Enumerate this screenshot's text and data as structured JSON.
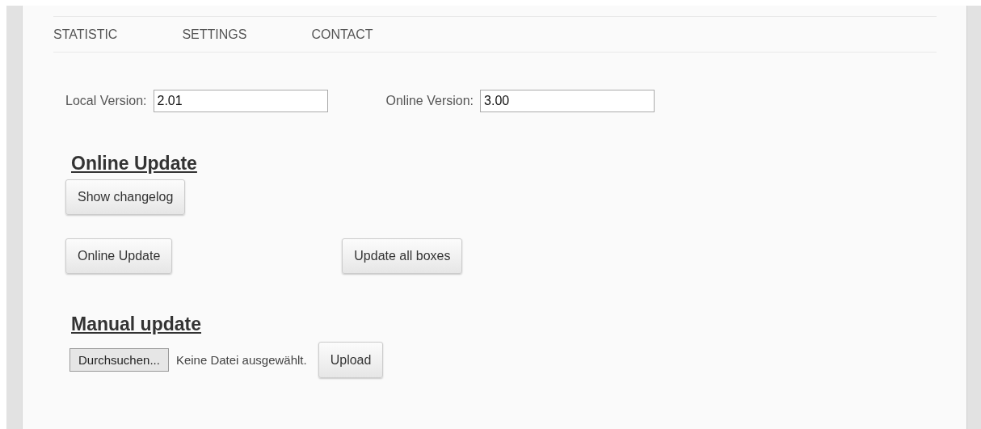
{
  "nav": [
    {
      "label": "STATISTIC"
    },
    {
      "label": "SETTINGS"
    },
    {
      "label": "CONTACT"
    }
  ],
  "versions": [
    {
      "label": "Local Version:",
      "value": "2.01"
    },
    {
      "label": "Online Version:",
      "value": "3.00"
    }
  ],
  "online_update": {
    "heading": "Online Update",
    "changelog_button": "Show changelog",
    "buttons": [
      "Online Update",
      "Update all boxes"
    ]
  },
  "manual_update": {
    "heading": "Manual update",
    "browse_button": "Durchsuchen...",
    "file_status": "Keine Datei ausgewählt.",
    "upload_button": "Upload"
  }
}
